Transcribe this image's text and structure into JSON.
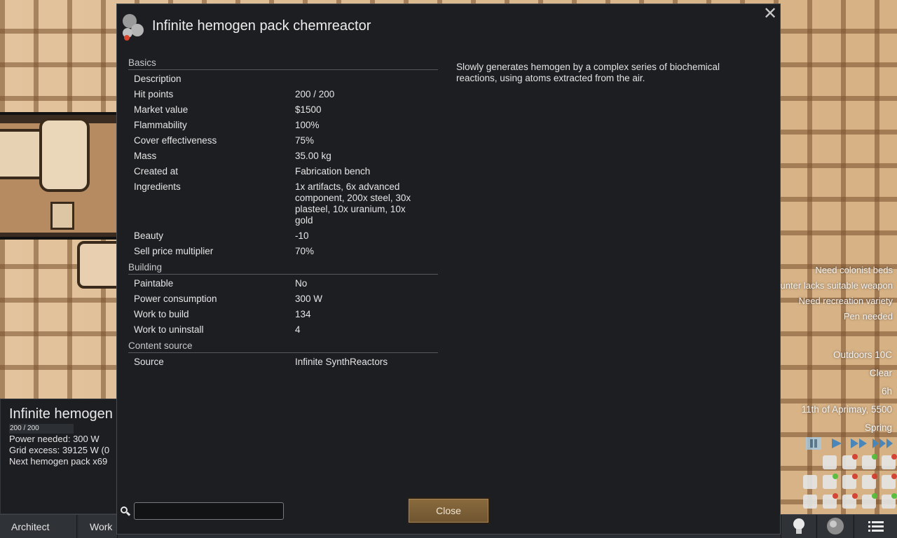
{
  "dialog": {
    "title": "Infinite hemogen pack chemreactor",
    "close_x": "✕",
    "description_text": "Slowly generates hemogen by a complex series of biochemical reactions, using atoms extracted from the air.",
    "search": {
      "value": "",
      "placeholder": ""
    },
    "close_button": "Close",
    "categories": {
      "basics": {
        "label": "Basics",
        "rows": [
          {
            "label": "Description",
            "value": ""
          },
          {
            "label": "Hit points",
            "value": "200 / 200"
          },
          {
            "label": "Market value",
            "value": "$1500"
          },
          {
            "label": "Flammability",
            "value": "100%"
          },
          {
            "label": "Cover effectiveness",
            "value": "75%"
          },
          {
            "label": "Mass",
            "value": "35.00 kg"
          },
          {
            "label": "Created at",
            "value": "Fabrication bench"
          },
          {
            "label": "Ingredients",
            "value": "1x artifacts, 6x advanced component, 200x steel, 30x plasteel, 10x uranium, 10x gold"
          },
          {
            "label": "Beauty",
            "value": "-10"
          },
          {
            "label": "Sell price multiplier",
            "value": "70%"
          }
        ]
      },
      "building": {
        "label": "Building",
        "rows": [
          {
            "label": "Paintable",
            "value": "No"
          },
          {
            "label": "Power consumption",
            "value": "300 W"
          },
          {
            "label": "Work to build",
            "value": "134"
          },
          {
            "label": "Work to uninstall",
            "value": "4"
          }
        ]
      },
      "content_source": {
        "label": "Content source",
        "rows": [
          {
            "label": "Source",
            "value": "Infinite SynthReactors"
          }
        ]
      }
    }
  },
  "inspect": {
    "title": "Infinite hemogen",
    "hp": "200 / 200",
    "lines": [
      "Power needed: 300 W",
      "Grid excess: 39125 W (0",
      "Next hemogen pack x69"
    ]
  },
  "main_tabs": [
    "Architect",
    "Work"
  ],
  "alerts": [
    "Need colonist beds",
    "Hunter lacks suitable weapon",
    "Need recreation variety",
    "Pen needed"
  ],
  "date": {
    "temperature": "Outdoors 10C",
    "weather": "Clear",
    "hour": "6h",
    "date": "11th of Aprimay, 5500",
    "season": "Spring"
  },
  "speed_controls": [
    "pause",
    "normal",
    "fast",
    "superfast"
  ],
  "colors": {
    "dialog_bg": "#1c1e21",
    "close_button": "#7a5e37",
    "speed_blue": "#4a86b8"
  },
  "icons": {
    "thing": "chemreactor-icon",
    "search": "search-icon",
    "learning_helper": "lightbulb-icon",
    "world": "planet-icon",
    "menu": "menu-icon"
  }
}
